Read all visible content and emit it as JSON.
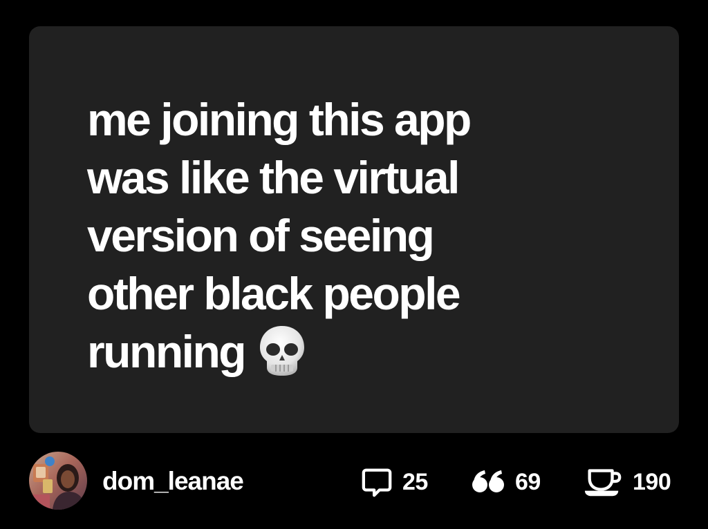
{
  "post": {
    "lines": [
      "me joining this app",
      "was like the virtual",
      "version of seeing",
      "other black people",
      "running"
    ],
    "emoji": "💀"
  },
  "author": {
    "username": "dom_leanae",
    "avatar_icon": "avatar-photo"
  },
  "stats": {
    "comments": {
      "icon": "speech-bubble-icon",
      "count": "25"
    },
    "quotes": {
      "icon": "quote-marks-icon",
      "count": "69"
    },
    "reposts": {
      "icon": "teacup-icon",
      "count": "190"
    }
  },
  "colors": {
    "background": "#000000",
    "card": "#212121",
    "text": "#ffffff"
  }
}
